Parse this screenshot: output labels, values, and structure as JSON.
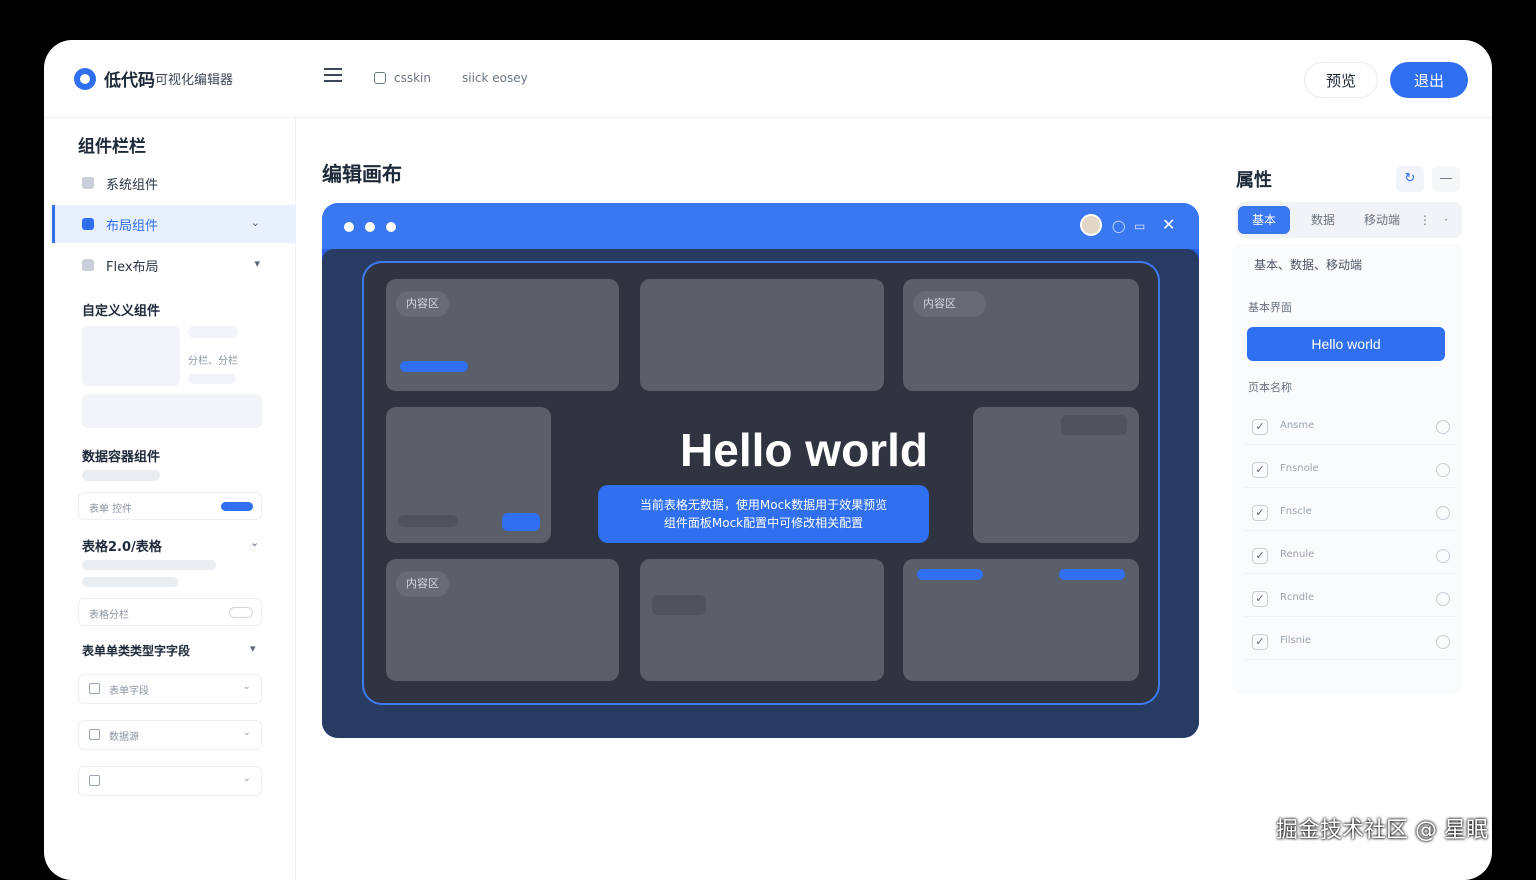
{
  "header": {
    "brand_main": "低代码",
    "brand_sub": "可视化编辑器",
    "breadcrumb_1": "csskin",
    "breadcrumb_2": "siick eosey",
    "preview_label": "预览",
    "exit_label": "退出"
  },
  "sidebar": {
    "title": "组件栏栏",
    "items": [
      {
        "label": "系统组件"
      },
      {
        "label": "布局组件"
      },
      {
        "label": "Flex布局"
      }
    ],
    "custom_title": "自定义义组件",
    "custom_caption": "分栏、分栏",
    "data_title": "数据容器组件",
    "data_field": "表单 控件",
    "table_title": "表格2.0/表格",
    "table_field": "表格分栏",
    "form_title": "表单单类类型字字段",
    "form_fields": [
      "表单字段",
      "数据源",
      ""
    ]
  },
  "canvas": {
    "title": "编辑画布",
    "tag_1": "内容区",
    "tag_2": "内容区",
    "tag_3": "内容区",
    "headline": "Hello world",
    "notice_line1": "当前表格无数据，使用Mock数据用于效果预览",
    "notice_line2": "组件面板Mock配置中可修改相关配置"
  },
  "properties": {
    "title": "属性",
    "refresh_icon": "refresh-icon",
    "tabs": [
      "基本",
      "数据",
      "移动端"
    ],
    "active_tab": "基本",
    "summary": "基本、数据、移动端",
    "basic_label": "基本界面",
    "hello_button": "Hello world",
    "page_name_label": "页本名称",
    "options": [
      {
        "label": "Ansme",
        "checked": true
      },
      {
        "label": "Fnsnole",
        "checked": true
      },
      {
        "label": "Fnscle",
        "checked": true
      },
      {
        "label": "Renule",
        "checked": true
      },
      {
        "label": "Rcndle",
        "checked": true
      },
      {
        "label": "Filsnie",
        "checked": true
      }
    ]
  },
  "watermark": "掘金技术社区 @ 星眠",
  "colors": {
    "accent": "#2f6ff0",
    "canvas_body": "#283b63",
    "card": "#5b5f69"
  }
}
